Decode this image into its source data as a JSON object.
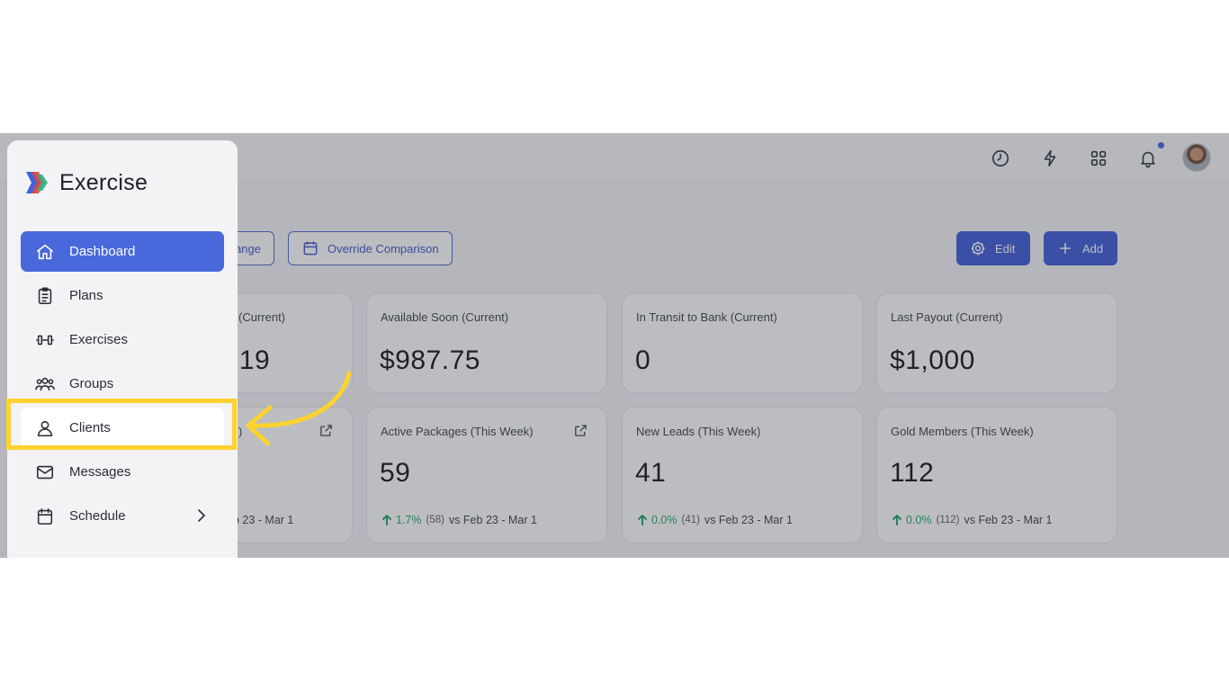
{
  "topbar": {
    "icons": [
      "clock-icon",
      "bolt-icon",
      "grid-icon",
      "bell-icon"
    ],
    "has_notification": true
  },
  "actions": {
    "change_label": "ange",
    "override_label": "Override Comparison",
    "edit_label": "Edit",
    "add_label": "Add"
  },
  "cards": [
    {
      "label": "(Current)",
      "value": ".19"
    },
    {
      "label": "Available Soon (Current)",
      "value": "$987.75"
    },
    {
      "label": "In Transit to Bank (Current)",
      "value": "0"
    },
    {
      "label": "Last Payout (Current)",
      "value": "$1,000"
    },
    {
      "label": ")",
      "value": "",
      "foot": "b 23 - Mar 1"
    },
    {
      "label": "Active Packages (This Week)",
      "value": "59",
      "delta": "1.7%",
      "prev": "(58)",
      "foot": "vs Feb 23 - Mar 1"
    },
    {
      "label": "New Leads (This Week)",
      "value": "41",
      "delta": "0.0%",
      "prev": "(41)",
      "foot": "vs Feb 23 - Mar 1"
    },
    {
      "label": "Gold Members (This Week)",
      "value": "112",
      "delta": "0.0%",
      "prev": "(112)",
      "foot": "vs Feb 23 - Mar 1"
    }
  ],
  "sidebar": {
    "brand": "Exercise",
    "items": [
      {
        "label": "Dashboard",
        "icon": "home-icon",
        "active": true
      },
      {
        "label": "Plans",
        "icon": "clipboard-icon"
      },
      {
        "label": "Exercises",
        "icon": "dumbbell-icon"
      },
      {
        "label": "Groups",
        "icon": "users-icon"
      },
      {
        "label": "Clients",
        "icon": "user-icon",
        "highlighted": true
      },
      {
        "label": "Messages",
        "icon": "mail-icon"
      },
      {
        "label": "Schedule",
        "icon": "calendar-icon"
      }
    ]
  },
  "colors": {
    "accent": "#4868db",
    "positive": "#1ea56b",
    "highlight": "#ffd22e"
  }
}
